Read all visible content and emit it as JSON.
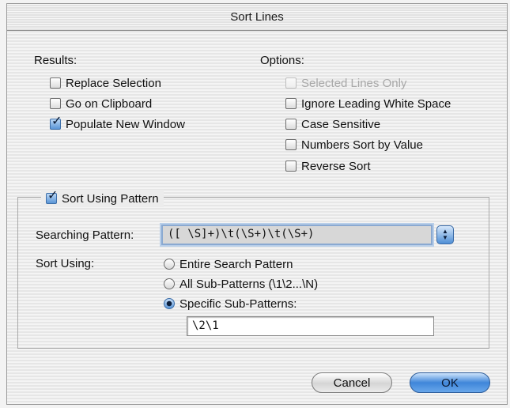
{
  "window": {
    "title": "Sort Lines"
  },
  "results": {
    "label": "Results:",
    "items": [
      {
        "label": "Replace Selection",
        "checked": false
      },
      {
        "label": "Go on Clipboard",
        "checked": false
      },
      {
        "label": "Populate New Window",
        "checked": true
      }
    ]
  },
  "options": {
    "label": "Options:",
    "items": [
      {
        "label": "Selected Lines Only",
        "checked": false,
        "enabled": false
      },
      {
        "label": "Ignore Leading White Space",
        "checked": false,
        "enabled": true
      },
      {
        "label": "Case Sensitive",
        "checked": false,
        "enabled": true
      },
      {
        "label": "Numbers Sort by Value",
        "checked": false,
        "enabled": true
      },
      {
        "label": "Reverse Sort",
        "checked": false,
        "enabled": true
      }
    ]
  },
  "pattern_group": {
    "label": "Sort Using Pattern",
    "checked": true,
    "searching_pattern_label": "Searching Pattern:",
    "searching_pattern_value": "([ \\S]+)\\t(\\S+)\\t(\\S+)",
    "sort_using_label": "Sort Using:",
    "radios": [
      {
        "label": "Entire Search Pattern",
        "selected": false
      },
      {
        "label": "All Sub-Patterns (\\1\\2...\\N)",
        "selected": false
      },
      {
        "label": "Specific Sub-Patterns:",
        "selected": true
      }
    ],
    "sub_patterns_value": "\\2\\1"
  },
  "buttons": {
    "cancel": "Cancel",
    "ok": "OK"
  }
}
